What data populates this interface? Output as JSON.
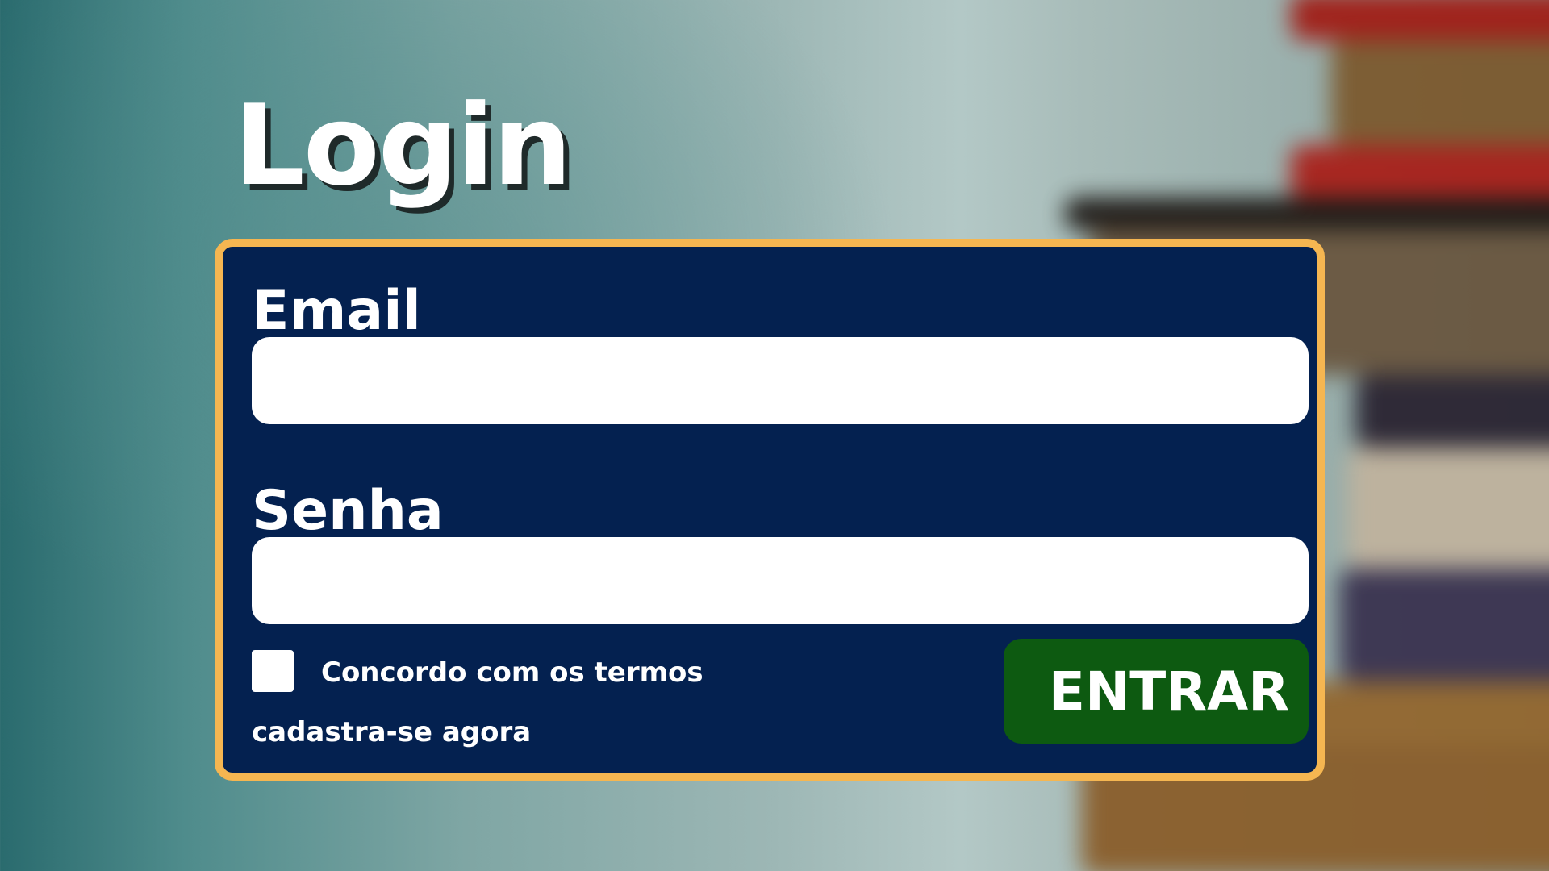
{
  "page": {
    "title": "Login"
  },
  "form": {
    "email_label": "Email",
    "email_value": "",
    "password_label": "Senha",
    "password_value": "",
    "terms_label": "Concordo com os termos",
    "terms_checked": false,
    "signup_link": "cadastra-se agora",
    "submit_label": "ENTRAR"
  },
  "colors": {
    "card_background": "#042150",
    "card_border": "#f5b651",
    "button_background": "#0d5a11",
    "text": "#ffffff"
  }
}
